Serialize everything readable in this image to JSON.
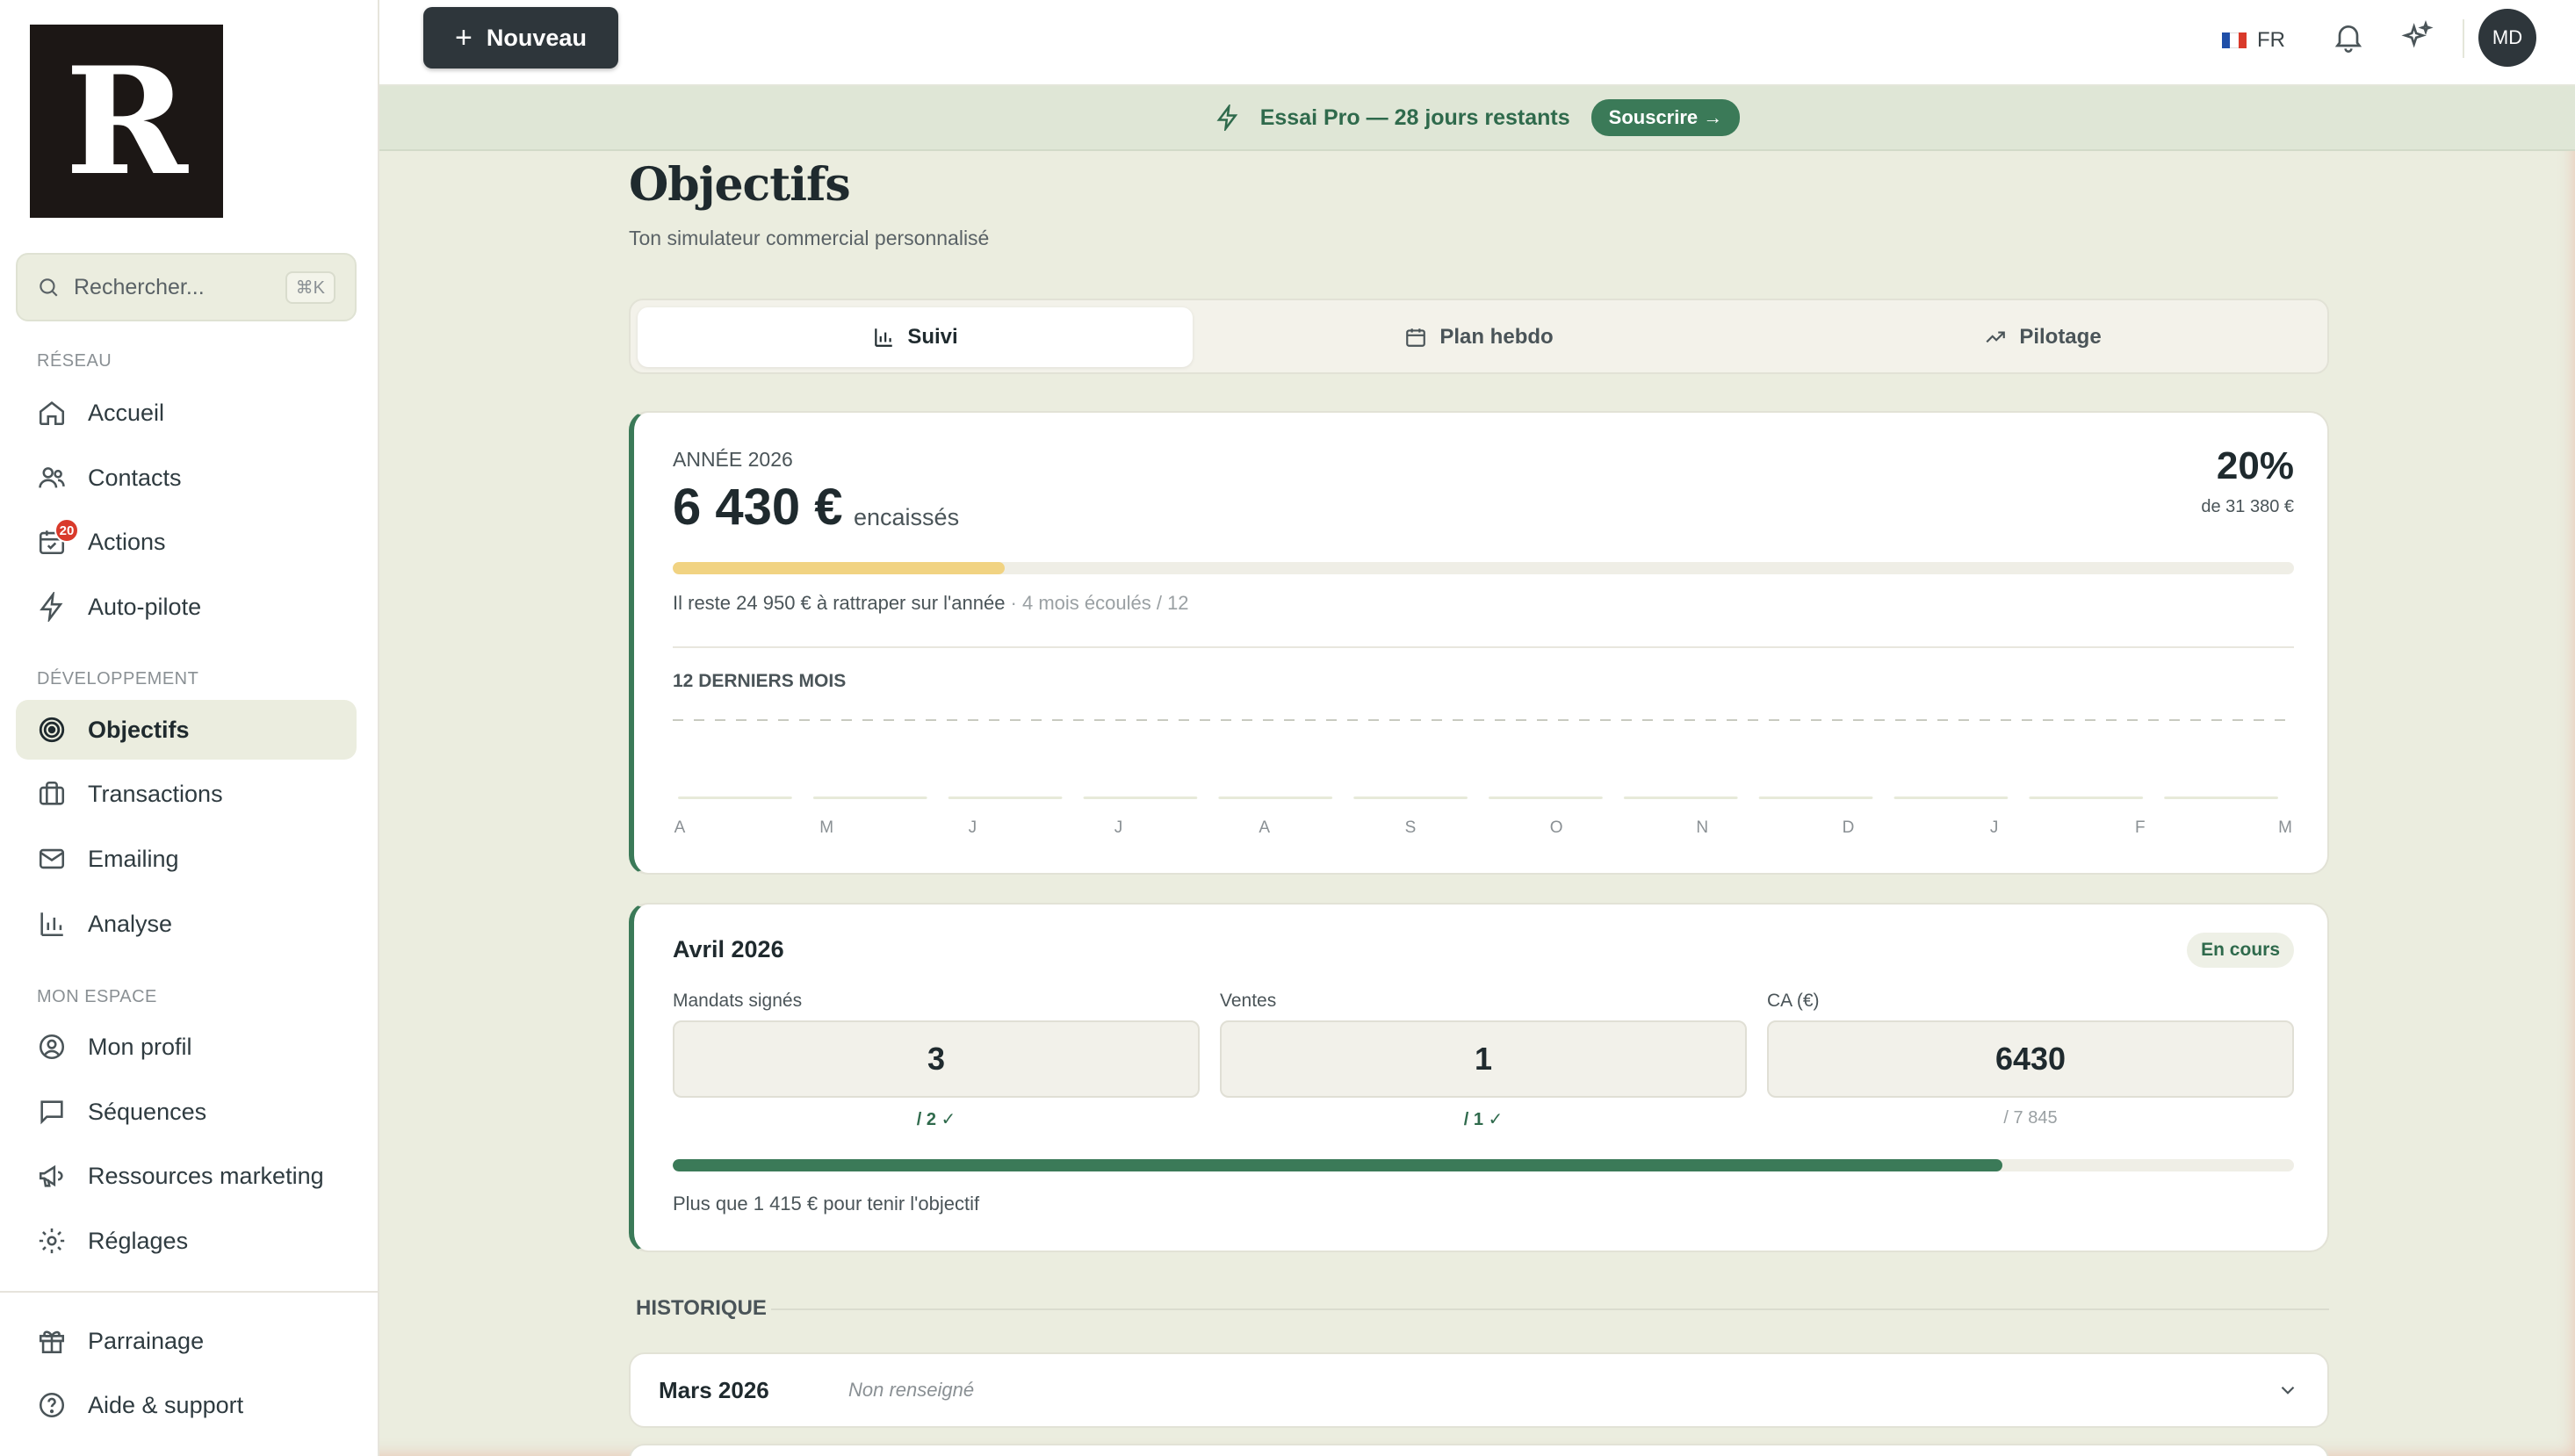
{
  "brand": {
    "logo_letter": "R"
  },
  "search": {
    "placeholder": "Rechercher...",
    "shortcut": "⌘K"
  },
  "sidebar": {
    "sections": [
      {
        "label": "RÉSEAU"
      },
      {
        "label": "DÉVELOPPEMENT"
      },
      {
        "label": "MON ESPACE"
      }
    ],
    "items": [
      {
        "label": "Accueil",
        "icon": "home-icon"
      },
      {
        "label": "Contacts",
        "icon": "users-icon"
      },
      {
        "label": "Actions",
        "icon": "calendar-check-icon",
        "badge": "20"
      },
      {
        "label": "Auto-pilote",
        "icon": "bolt-icon"
      },
      {
        "label": "Objectifs",
        "icon": "target-icon",
        "active": true
      },
      {
        "label": "Transactions",
        "icon": "briefcase-icon"
      },
      {
        "label": "Emailing",
        "icon": "mail-icon"
      },
      {
        "label": "Analyse",
        "icon": "bar-chart-icon"
      },
      {
        "label": "Mon profil",
        "icon": "user-circle-icon"
      },
      {
        "label": "Séquences",
        "icon": "message-square-icon"
      },
      {
        "label": "Ressources marketing",
        "icon": "megaphone-icon"
      },
      {
        "label": "Réglages",
        "icon": "gear-icon"
      },
      {
        "label": "Parrainage",
        "icon": "gift-icon"
      },
      {
        "label": "Aide & support",
        "icon": "help-circle-icon"
      }
    ]
  },
  "topbar": {
    "new_label": "Nouveau",
    "lang": "FR",
    "avatar_initials": "MD"
  },
  "banner": {
    "text": "Essai Pro — 28 jours restants",
    "cta": "Souscrire →"
  },
  "page": {
    "title": "Objectifs",
    "subtitle": "Ton simulateur commercial personnalisé"
  },
  "tabs": [
    {
      "label": "Suivi",
      "icon": "bar-chart-icon",
      "active": true
    },
    {
      "label": "Plan hebdo",
      "icon": "calendar-icon"
    },
    {
      "label": "Pilotage",
      "icon": "trending-up-icon"
    }
  ],
  "year": {
    "label": "ANNÉE 2026",
    "amount": "6 430 €",
    "suffix": "encaissés",
    "percent": "20%",
    "of_total": "de 31 380 €",
    "progress": 0.205,
    "remaining": "Il reste 24 950 € à rattraper sur l'année",
    "elapsed": " · 4 mois écoulés / 12",
    "chart_label": "12 DERNIERS MOIS"
  },
  "chart_data": {
    "type": "bar",
    "categories": [
      "A",
      "M",
      "J",
      "J",
      "A",
      "S",
      "O",
      "N",
      "D",
      "J",
      "F",
      "M"
    ],
    "values": [
      0,
      0,
      0,
      0,
      0,
      0,
      0,
      0,
      0,
      0,
      0,
      0
    ],
    "target_line": true
  },
  "month": {
    "title": "Avril 2026",
    "status": "En cours",
    "kpis": [
      {
        "label": "Mandats signés",
        "value": "3",
        "target": "/ 2 ✓",
        "met": true
      },
      {
        "label": "Ventes",
        "value": "1",
        "target": "/ 1 ✓",
        "met": true
      },
      {
        "label": "CA (€)",
        "value": "6430",
        "target": "/ 7 845",
        "met": false
      }
    ],
    "progress": 0.82,
    "note": "Plus que 1 415 € pour tenir l'objectif"
  },
  "history": {
    "label": "HISTORIQUE",
    "rows": [
      {
        "month": "Mars 2026",
        "status": "Non renseigné"
      }
    ]
  },
  "colors": {
    "accent": "#3b7a58",
    "year_progress": "#f1d382",
    "dark": "#2e363b",
    "badge": "#d93a2b"
  }
}
